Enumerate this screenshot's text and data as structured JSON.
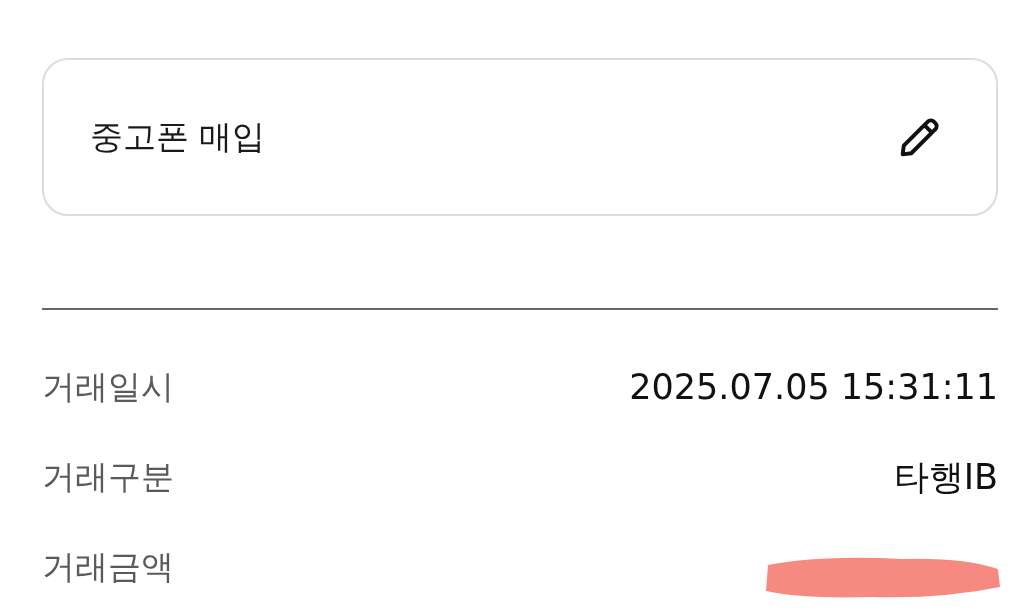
{
  "memo": {
    "value": "중고폰 매입"
  },
  "details": [
    {
      "label": "거래일시",
      "value": "2025.07.05 15:31:11",
      "redacted": false
    },
    {
      "label": "거래구분",
      "value": "타행IB",
      "redacted": false
    },
    {
      "label": "거래금액",
      "redacted": true
    }
  ]
}
